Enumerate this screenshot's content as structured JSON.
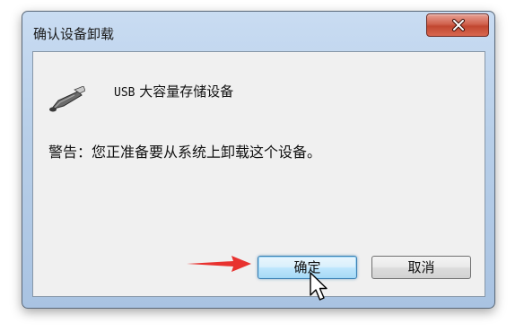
{
  "dialog": {
    "title": "确认设备卸载",
    "device_name_prefix": "USB",
    "device_name_rest": " 大容量存储设备",
    "warning_text": "警告：您正准备要从系统上卸载这个设备。",
    "ok_label": "确定",
    "cancel_label": "取消"
  },
  "icons": {
    "close": "close-icon",
    "device": "usb-drive-icon",
    "annotation": "red-arrow-icon",
    "pointer": "mouse-cursor-icon"
  },
  "colors": {
    "close_button": "#c14731",
    "annotation_arrow": "#e8322f",
    "ok_border": "#3c7fb1"
  }
}
